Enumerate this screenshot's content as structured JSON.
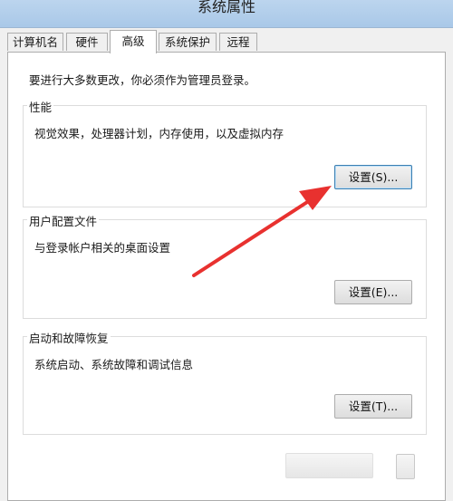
{
  "window": {
    "title": "系统属性"
  },
  "tabs": [
    {
      "label": "计算机名"
    },
    {
      "label": "硬件"
    },
    {
      "label": "高级"
    },
    {
      "label": "系统保护"
    },
    {
      "label": "远程"
    }
  ],
  "admin_note": "要进行大多数更改，你必须作为管理员登录。",
  "performance": {
    "legend": "性能",
    "description": "视觉效果，处理器计划，内存使用，以及虚拟内存",
    "button": "设置(S)..."
  },
  "user_profiles": {
    "legend": "用户配置文件",
    "description": "与登录帐户相关的桌面设置",
    "button": "设置(E)..."
  },
  "startup_recovery": {
    "legend": "启动和故障恢复",
    "description": "系统启动、系统故障和调试信息",
    "button": "设置(T)..."
  },
  "colors": {
    "arrow": "#e8312f",
    "focus_border": "#3c7fb1"
  }
}
